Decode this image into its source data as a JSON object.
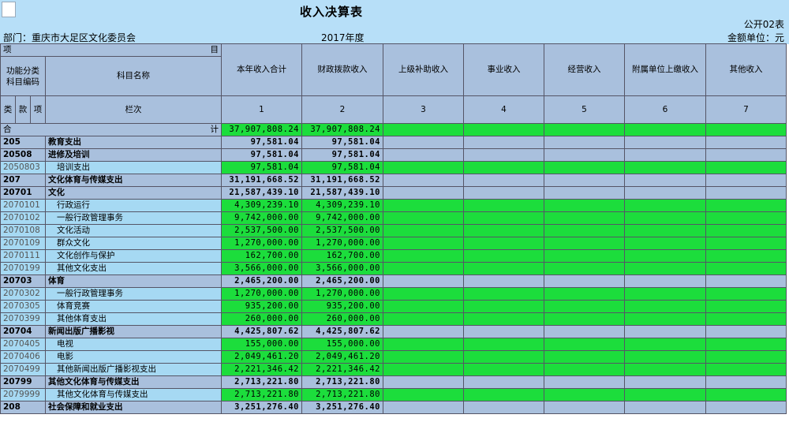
{
  "header": {
    "title": "收入决算表",
    "form_no": "公开02表",
    "department": "部门：重庆市大足区文化委员会",
    "year": "2017年度",
    "unit": "金额单位：元"
  },
  "columns": {
    "xiang": "项",
    "mu": "目",
    "func_code": "功能分类科目编码",
    "subject_name": "科目名称",
    "lanci": "栏次",
    "lei": "类",
    "kuan": "款",
    "xiang2": "项",
    "heji": "合",
    "ji": "计",
    "data_cols": [
      "本年收入合计",
      "财政拨款收入",
      "上级补助收入",
      "事业收入",
      "经营收入",
      "附属单位上缴收入",
      "其他收入"
    ],
    "col_numbers": [
      "1",
      "2",
      "3",
      "4",
      "5",
      "6",
      "7"
    ]
  },
  "total": {
    "col1": "37,907,808.24",
    "col2": "37,907,808.24"
  },
  "rows": [
    {
      "code": "205",
      "name": "教育支出",
      "v1": "97,581.04",
      "v2": "97,581.04",
      "level": 1
    },
    {
      "code": "20508",
      "name": "进修及培训",
      "v1": "97,581.04",
      "v2": "97,581.04",
      "level": 2
    },
    {
      "code": "2050803",
      "name": "培训支出",
      "v1": "97,581.04",
      "v2": "97,581.04",
      "level": 3
    },
    {
      "code": "207",
      "name": "文化体育与传媒支出",
      "v1": "31,191,668.52",
      "v2": "31,191,668.52",
      "level": 1
    },
    {
      "code": "20701",
      "name": "文化",
      "v1": "21,587,439.10",
      "v2": "21,587,439.10",
      "level": 2
    },
    {
      "code": "2070101",
      "name": "行政运行",
      "v1": "4,309,239.10",
      "v2": "4,309,239.10",
      "level": 3
    },
    {
      "code": "2070102",
      "name": "一般行政管理事务",
      "v1": "9,742,000.00",
      "v2": "9,742,000.00",
      "level": 3
    },
    {
      "code": "2070108",
      "name": "文化活动",
      "v1": "2,537,500.00",
      "v2": "2,537,500.00",
      "level": 3
    },
    {
      "code": "2070109",
      "name": "群众文化",
      "v1": "1,270,000.00",
      "v2": "1,270,000.00",
      "level": 3
    },
    {
      "code": "2070111",
      "name": "文化创作与保护",
      "v1": "162,700.00",
      "v2": "162,700.00",
      "level": 3
    },
    {
      "code": "2070199",
      "name": "其他文化支出",
      "v1": "3,566,000.00",
      "v2": "3,566,000.00",
      "level": 3
    },
    {
      "code": "20703",
      "name": "体育",
      "v1": "2,465,200.00",
      "v2": "2,465,200.00",
      "level": 2
    },
    {
      "code": "2070302",
      "name": "一般行政管理事务",
      "v1": "1,270,000.00",
      "v2": "1,270,000.00",
      "level": 3
    },
    {
      "code": "2070305",
      "name": "体育竞赛",
      "v1": "935,200.00",
      "v2": "935,200.00",
      "level": 3
    },
    {
      "code": "2070399",
      "name": "其他体育支出",
      "v1": "260,000.00",
      "v2": "260,000.00",
      "level": 3
    },
    {
      "code": "20704",
      "name": "新闻出版广播影视",
      "v1": "4,425,807.62",
      "v2": "4,425,807.62",
      "level": 2
    },
    {
      "code": "2070405",
      "name": "电视",
      "v1": "155,000.00",
      "v2": "155,000.00",
      "level": 3
    },
    {
      "code": "2070406",
      "name": "电影",
      "v1": "2,049,461.20",
      "v2": "2,049,461.20",
      "level": 3
    },
    {
      "code": "2070499",
      "name": "其他新闻出版广播影视支出",
      "v1": "2,221,346.42",
      "v2": "2,221,346.42",
      "level": 3
    },
    {
      "code": "20799",
      "name": "其他文化体育与传媒支出",
      "v1": "2,713,221.80",
      "v2": "2,713,221.80",
      "level": 2
    },
    {
      "code": "2079999",
      "name": "其他文化体育与传媒支出",
      "v1": "2,713,221.80",
      "v2": "2,713,221.80",
      "level": 3
    },
    {
      "code": "208",
      "name": "社会保障和就业支出",
      "v1": "3,251,276.40",
      "v2": "3,251,276.40",
      "level": 1
    }
  ],
  "colors": {
    "green": "#1cdd3c",
    "header_blue": "#a9c0dd",
    "light_blue": "#a6d9f3",
    "top_bg": "#b7dff8"
  }
}
